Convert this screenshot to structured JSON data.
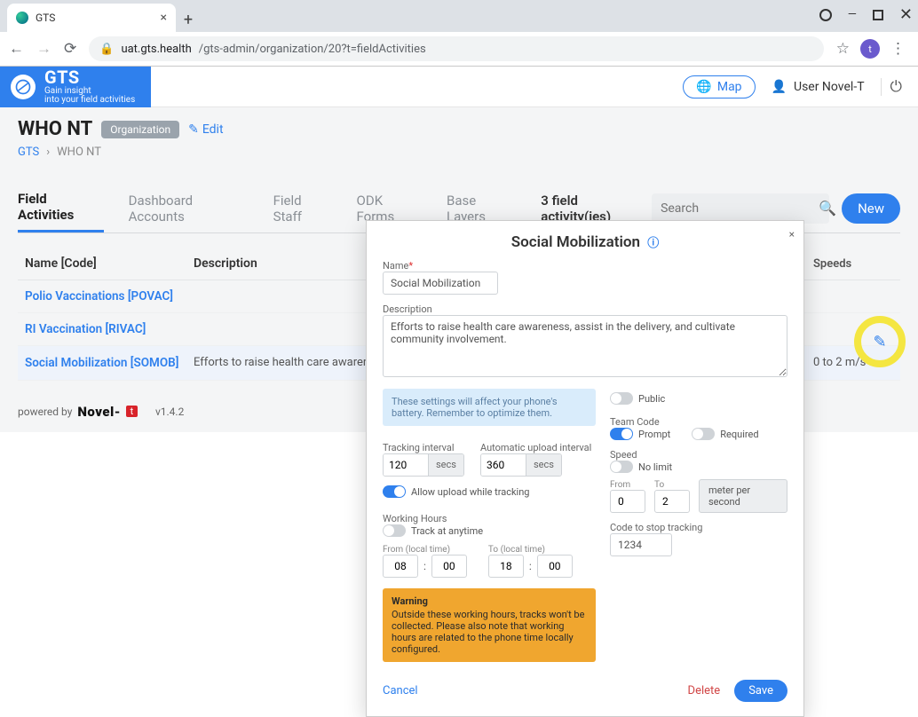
{
  "browser": {
    "tab_title": "GTS",
    "url_host": "uat.gts.health",
    "url_path": "/gts-admin/organization/20?t=fieldActivities",
    "avatar_letter": "t"
  },
  "brand": {
    "name": "GTS",
    "tag1": "Gain insight",
    "tag2": "into your field activities"
  },
  "header": {
    "map_btn": "Map",
    "user_label": "User Novel-T"
  },
  "page": {
    "title": "WHO NT",
    "chip": "Organization",
    "edit": "Edit",
    "breadcrumb_root": "GTS",
    "breadcrumb_current": "WHO NT"
  },
  "tabs": {
    "items": [
      "Field Activities",
      "Dashboard Accounts",
      "Field Staff",
      "ODK Forms",
      "Base Layers"
    ],
    "active_index": 0,
    "count_text": "3 field activity(ies)",
    "search_placeholder": "Search",
    "new_btn": "New"
  },
  "table": {
    "headers": {
      "name": "Name [Code]",
      "desc": "Description",
      "speeds": "Speeds"
    },
    "rows": [
      {
        "name": "Polio Vaccinations [POVAC]",
        "desc": "",
        "speeds": ""
      },
      {
        "name": "RI Vaccination [RIVAC]",
        "desc": "",
        "speeds": ""
      },
      {
        "name": "Social Mobilization [SOMOB]",
        "desc": "Efforts to raise health care awareness, assist in the delivery, and cultivate community involvement.",
        "speeds": "0 to 2 m/s"
      }
    ]
  },
  "footer": {
    "powered": "powered by",
    "brand": "Novel-",
    "flag": "t",
    "version": "v1.4.2"
  },
  "modal": {
    "title": "Social Mobilization",
    "labels": {
      "name": "Name",
      "description": "Description",
      "tracking_interval": "Tracking interval",
      "auto_upload": "Automatic upload interval",
      "allow_upload": "Allow upload while tracking",
      "working_hours": "Working Hours",
      "track_anytime": "Track at anytime",
      "from_local": "From (local time)",
      "to_local": "To (local time)",
      "public": "Public",
      "team_code": "Team Code",
      "prompt": "Prompt",
      "required": "Required",
      "speed": "Speed",
      "no_limit": "No limit",
      "from": "From",
      "to": "To",
      "speed_unit": "meter per second",
      "stop_code": "Code to stop tracking",
      "secs": "secs"
    },
    "values": {
      "name": "Social Mobilization",
      "description": "Efforts to raise health care awareness, assist in the delivery, and cultivate community involvement.",
      "tracking_interval": "120",
      "auto_upload": "360",
      "from_h": "08",
      "from_m": "00",
      "to_h": "18",
      "to_m": "00",
      "speed_from": "0",
      "speed_to": "2",
      "stop_code": "1234"
    },
    "info_box": "These settings will affect your phone's battery. Remember to optimize them.",
    "warning_title": "Warning",
    "warning_body": "Outside these working hours, tracks won't be collected. Please also note that working hours are related to the phone time locally configured.",
    "actions": {
      "cancel": "Cancel",
      "delete": "Delete",
      "save": "Save"
    }
  }
}
